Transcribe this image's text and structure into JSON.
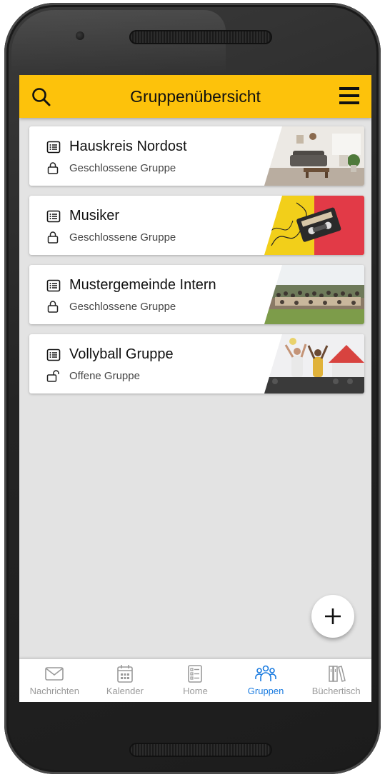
{
  "header": {
    "title": "Gruppenübersicht",
    "search_icon": "search-icon",
    "menu_icon": "hamburger-menu-icon",
    "background_color": "#fdc20b"
  },
  "groups": [
    {
      "name": "Hauskreis Nordost",
      "status": "Geschlossene Gruppe",
      "status_icon": "lock-closed-icon",
      "thumbnail": "living-room-photo"
    },
    {
      "name": "Musiker",
      "status": "Geschlossene Gruppe",
      "status_icon": "lock-closed-icon",
      "thumbnail": "cassette-tape-photo"
    },
    {
      "name": "Mustergemeinde Intern",
      "status": "Geschlossene Gruppe",
      "status_icon": "lock-closed-icon",
      "thumbnail": "group-photo"
    },
    {
      "name": "Vollyball Gruppe",
      "status": "Offene Gruppe",
      "status_icon": "lock-open-icon",
      "thumbnail": "volleyball-photo"
    }
  ],
  "fab": {
    "icon": "plus-icon"
  },
  "bottom_nav": {
    "items": [
      {
        "label": "Nachrichten",
        "icon": "envelope-icon",
        "active": false
      },
      {
        "label": "Kalender",
        "icon": "calendar-icon",
        "active": false
      },
      {
        "label": "Home",
        "icon": "home-list-icon",
        "active": false
      },
      {
        "label": "Gruppen",
        "icon": "people-icon",
        "active": true
      },
      {
        "label": "Büchertisch",
        "icon": "books-icon",
        "active": false
      }
    ],
    "active_color": "#1a7be0",
    "inactive_color": "#9a9a9a"
  }
}
